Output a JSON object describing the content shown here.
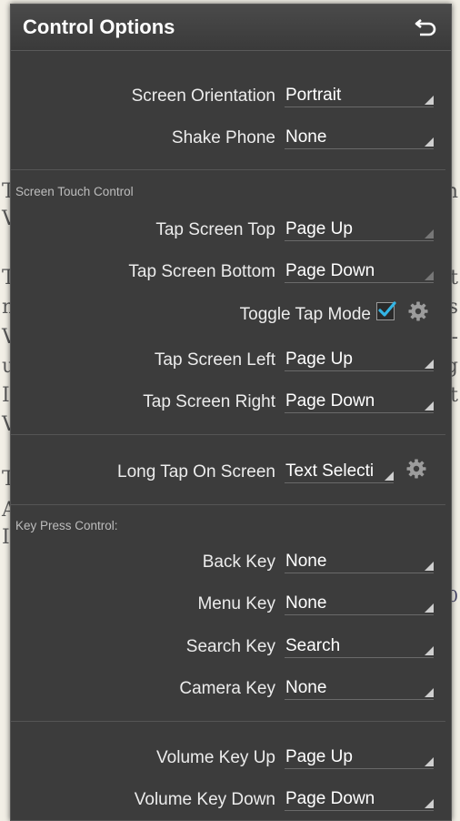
{
  "title": "Control Options",
  "background_fragments": {
    "left": [
      "T",
      "V",
      "T",
      "n",
      "V",
      "u",
      "I",
      "V",
      "T",
      "A",
      "I"
    ],
    "right": [
      "n",
      "t",
      "s",
      "-",
      "g",
      "t",
      "0"
    ]
  },
  "general": [
    {
      "label": "Screen Orientation",
      "value": "Portrait"
    },
    {
      "label": "Shake Phone",
      "value": "None"
    }
  ],
  "screen_touch": {
    "section_label": "Screen Touch Control",
    "tap_top": {
      "label": "Tap Screen Top",
      "value": "Page Up"
    },
    "tap_bottom": {
      "label": "Tap Screen Bottom",
      "value": "Page Down"
    },
    "toggle_tap_mode": {
      "label": "Toggle Tap Mode",
      "checked": true
    },
    "tap_left": {
      "label": "Tap Screen Left",
      "value": "Page Up"
    },
    "tap_right": {
      "label": "Tap Screen Right",
      "value": "Page Down"
    }
  },
  "long_tap": {
    "label": "Long Tap On Screen",
    "value": "Text Selecti"
  },
  "key_press": {
    "section_label": "Key Press Control:",
    "items": [
      {
        "label": "Back Key",
        "value": "None"
      },
      {
        "label": "Menu Key",
        "value": "None"
      },
      {
        "label": "Search Key",
        "value": "Search"
      },
      {
        "label": "Camera Key",
        "value": "None"
      }
    ]
  },
  "volume": [
    {
      "label": "Volume Key Up",
      "value": "Page Up"
    },
    {
      "label": "Volume Key Down",
      "value": "Page Down"
    }
  ],
  "colors": {
    "accent_check": "#33b5e5",
    "dialog_bg": "#3c3c3c"
  },
  "icons": {
    "back": "back-arrow-icon",
    "settings": "gear-icon"
  }
}
